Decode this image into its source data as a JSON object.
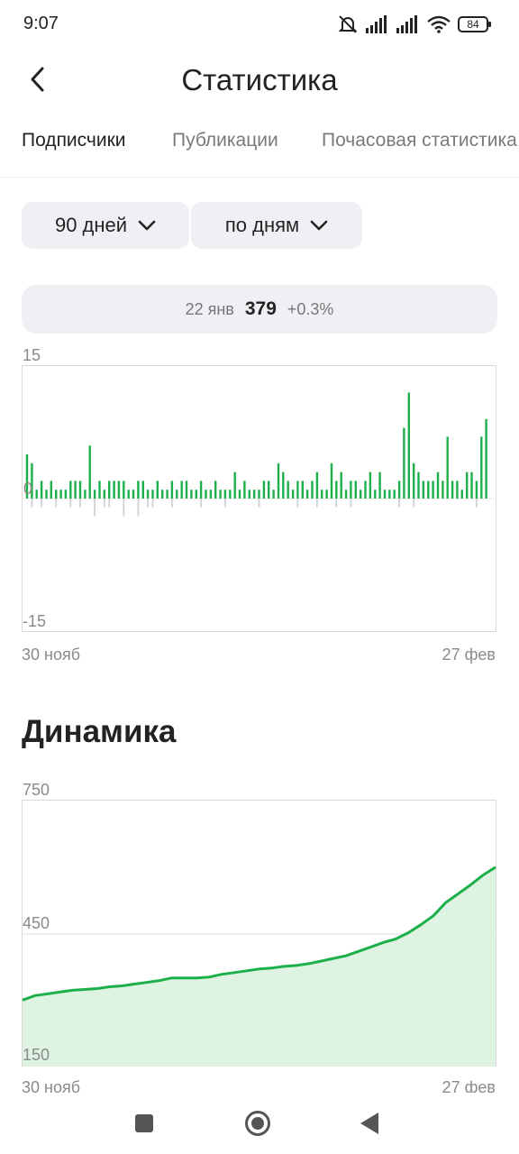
{
  "status_bar": {
    "time": "9:07",
    "battery": "84"
  },
  "header": {
    "title": "Статистика",
    "back_icon": "chevron-left-icon"
  },
  "tabs": [
    {
      "label": "Подписчики",
      "active": true
    },
    {
      "label": "Публикации",
      "active": false
    },
    {
      "label": "Почасовая статистика",
      "active": false
    }
  ],
  "filters": {
    "period": {
      "label": "90 дней",
      "icon": "chevron-down-icon"
    },
    "granularity": {
      "label": "по дням",
      "icon": "chevron-down-icon"
    }
  },
  "tooltip": {
    "date": "22 янв",
    "value": "379",
    "change": "+0.3%"
  },
  "colors": {
    "accent": "#1db04a",
    "negative": "#cfd2d6",
    "area_fill": "#dff3e3",
    "grid": "#d9d9d9"
  },
  "chart_data": [
    {
      "type": "bar",
      "ylim": [
        -15,
        15
      ],
      "y_ticks": [
        "15",
        "0",
        "-15"
      ],
      "x_start_label": "30 нояб",
      "x_end_label": "27 фев",
      "grid": true,
      "values": [
        5,
        4,
        1,
        2,
        1,
        2,
        1,
        1,
        1,
        2,
        2,
        2,
        1,
        6,
        1,
        2,
        1,
        2,
        2,
        2,
        2,
        1,
        1,
        2,
        2,
        1,
        1,
        2,
        1,
        1,
        2,
        1,
        2,
        2,
        1,
        1,
        2,
        1,
        1,
        2,
        1,
        1,
        1,
        3,
        1,
        2,
        1,
        1,
        1,
        2,
        2,
        1,
        4,
        3,
        2,
        1,
        2,
        2,
        1,
        2,
        3,
        1,
        1,
        4,
        2,
        3,
        1,
        2,
        2,
        1,
        2,
        3,
        1,
        3,
        1,
        1,
        1,
        2,
        8,
        12,
        4,
        3,
        2,
        2,
        2,
        3,
        2,
        7,
        2,
        2,
        1,
        3,
        3,
        2,
        7,
        9,
        0
      ],
      "negatives": [
        0,
        -1,
        0,
        -1,
        0,
        0,
        -1,
        0,
        0,
        -1,
        0,
        -1,
        0,
        0,
        -2,
        0,
        -1,
        -1,
        0,
        0,
        -2,
        0,
        0,
        -2,
        0,
        -1,
        -1,
        0,
        0,
        0,
        -1,
        0,
        0,
        0,
        0,
        0,
        -1,
        0,
        0,
        0,
        0,
        -1,
        0,
        0,
        0,
        0,
        0,
        0,
        -1,
        0,
        0,
        0,
        0,
        0,
        0,
        0,
        -1,
        0,
        0,
        0,
        -1,
        0,
        0,
        0,
        -1,
        0,
        0,
        -1,
        0,
        0,
        0,
        0,
        0,
        0,
        0,
        0,
        0,
        -1,
        0,
        0,
        -1,
        0,
        0,
        0,
        0,
        0,
        0,
        0,
        0,
        0,
        0,
        0,
        0,
        -1,
        0,
        0,
        0
      ]
    },
    {
      "type": "area",
      "title": "Динамика",
      "ylim": [
        150,
        750
      ],
      "y_ticks": [
        "750",
        "450",
        "150"
      ],
      "x_start_label": "30 нояб",
      "x_end_label": "27 фев",
      "grid": true,
      "values": [
        300,
        310,
        314,
        318,
        322,
        324,
        326,
        330,
        332,
        336,
        340,
        344,
        350,
        350,
        350,
        352,
        358,
        362,
        366,
        370,
        372,
        376,
        378,
        382,
        388,
        394,
        400,
        410,
        420,
        430,
        438,
        452,
        470,
        490,
        520,
        540,
        560,
        582,
        600
      ]
    }
  ],
  "nav_bar": {
    "recents_icon": "square-icon",
    "home_icon": "circle-icon",
    "back_icon": "triangle-back-icon"
  }
}
